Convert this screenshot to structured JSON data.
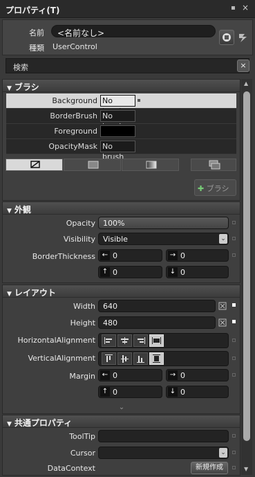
{
  "window": {
    "title": "プロパティ(T)"
  },
  "object": {
    "name_label": "名前",
    "name_value": "<名前なし>",
    "type_label": "種類",
    "type_value": "UserControl"
  },
  "search": {
    "placeholder": "検索",
    "clear": "×"
  },
  "brush": {
    "header": "ブラシ",
    "rows": [
      {
        "name": "Background",
        "value": "No brush"
      },
      {
        "name": "BorderBrush",
        "value": "No brush"
      },
      {
        "name": "Foreground",
        "value": ""
      },
      {
        "name": "OpacityMask",
        "value": "No brush"
      }
    ],
    "add_button": "ブラシ"
  },
  "appearance": {
    "header": "外観",
    "opacity_label": "Opacity",
    "opacity_value": "100%",
    "visibility_label": "Visibility",
    "visibility_value": "Visible",
    "border_label": "BorderThickness",
    "left": "0",
    "right": "0",
    "top": "0",
    "bottom": "0"
  },
  "layout": {
    "header": "レイアウト",
    "width_label": "Width",
    "width_value": "640",
    "height_label": "Height",
    "height_value": "480",
    "halign_label": "HorizontalAlignment",
    "valign_label": "VerticalAlignment",
    "margin_label": "Margin",
    "m_left": "0",
    "m_right": "0",
    "m_top": "0",
    "m_bottom": "0"
  },
  "common": {
    "header": "共通プロパティ",
    "tooltip_label": "ToolTip",
    "cursor_label": "Cursor",
    "datacontext_label": "DataContext",
    "new_button": "新規作成"
  }
}
